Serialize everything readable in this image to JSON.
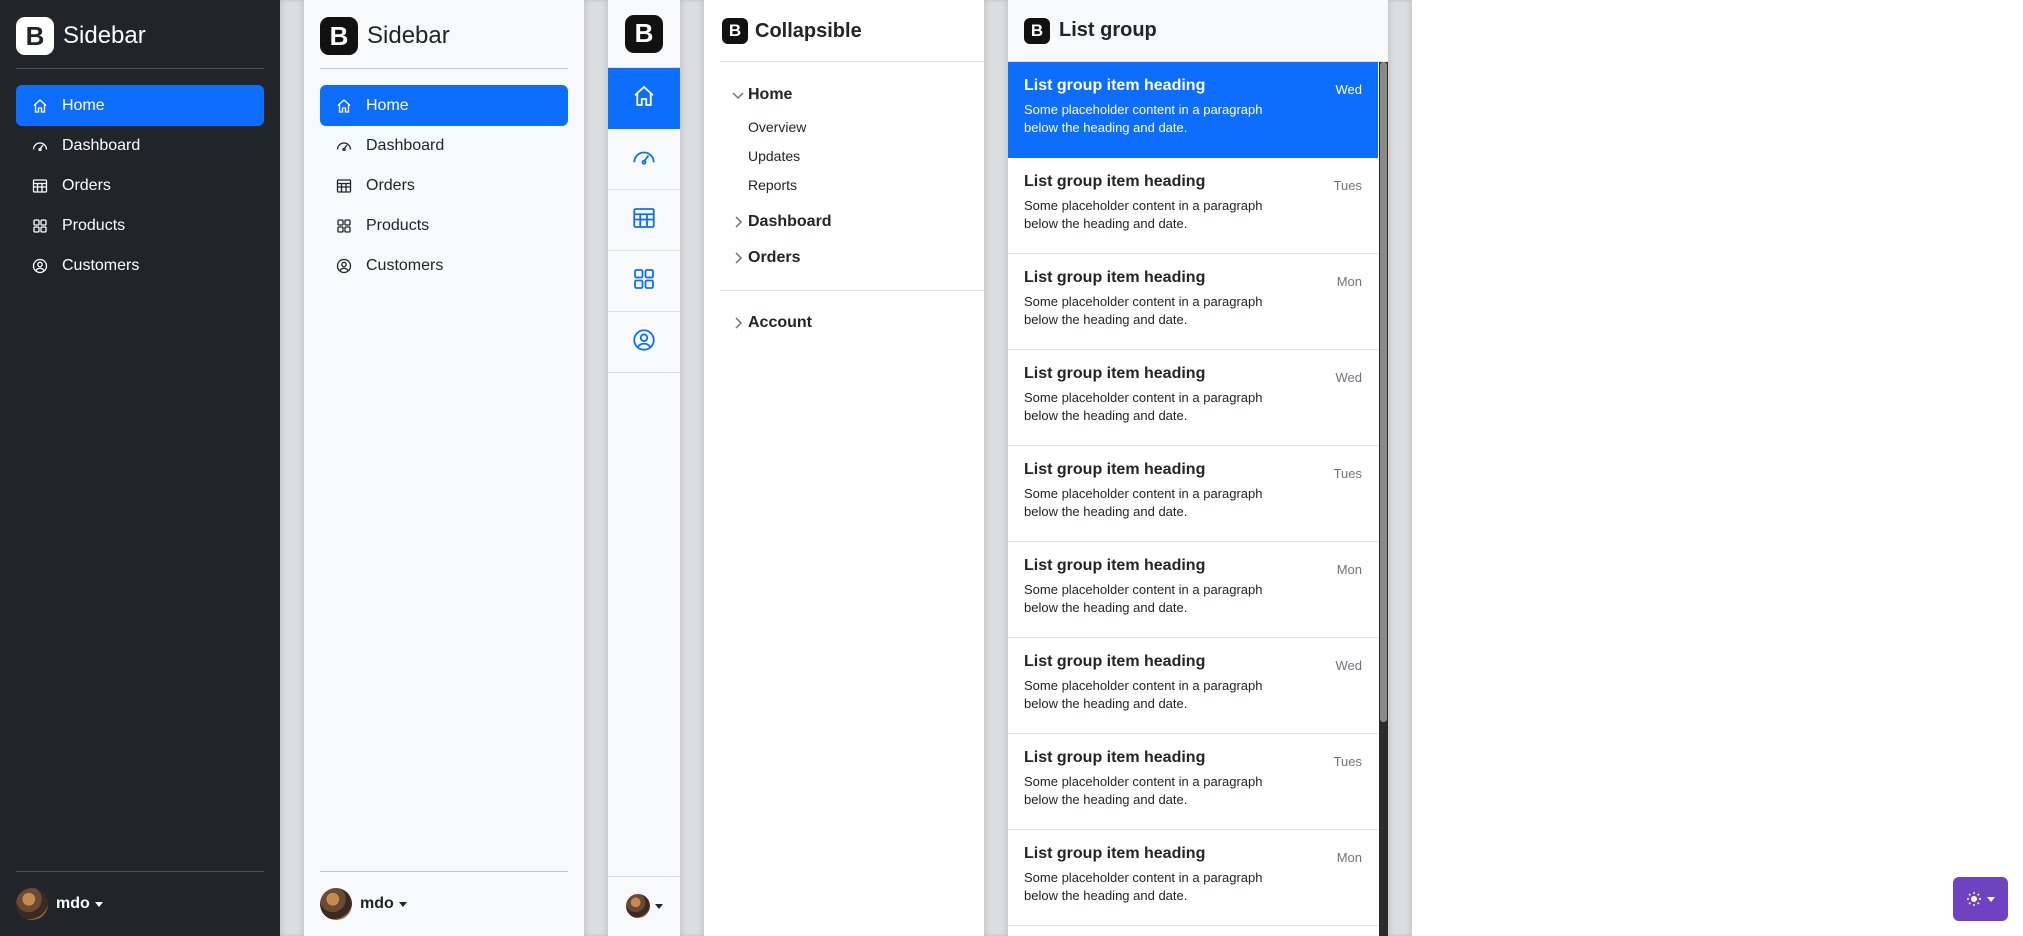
{
  "colors": {
    "primary": "#0d6efd",
    "dark_bg": "#212529",
    "light_bg": "#f8f9fa",
    "theme_btn": "#6f42c1"
  },
  "sidebar_dark": {
    "brand": "Sidebar",
    "items": [
      {
        "label": "Home",
        "icon": "home-icon"
      },
      {
        "label": "Dashboard",
        "icon": "speedometer-icon"
      },
      {
        "label": "Orders",
        "icon": "table-icon"
      },
      {
        "label": "Products",
        "icon": "grid-icon"
      },
      {
        "label": "Customers",
        "icon": "person-circle-icon"
      }
    ],
    "user": "mdo"
  },
  "sidebar_light": {
    "brand": "Sidebar",
    "items": [
      {
        "label": "Home",
        "icon": "home-icon"
      },
      {
        "label": "Dashboard",
        "icon": "speedometer-icon"
      },
      {
        "label": "Orders",
        "icon": "table-icon"
      },
      {
        "label": "Products",
        "icon": "grid-icon"
      },
      {
        "label": "Customers",
        "icon": "person-circle-icon"
      }
    ],
    "user": "mdo"
  },
  "icon_rail": {
    "items": [
      "home-icon",
      "speedometer-icon",
      "table-icon",
      "grid-icon",
      "person-circle-icon"
    ]
  },
  "collapsible": {
    "title": "Collapsible",
    "home": "Home",
    "home_children": [
      "Overview",
      "Updates",
      "Reports"
    ],
    "dashboard": "Dashboard",
    "orders": "Orders",
    "account": "Account"
  },
  "list_group": {
    "title": "List group",
    "items": [
      {
        "heading": "List group item heading",
        "text": "Some placeholder content in a paragraph below the heading and date.",
        "day": "Wed"
      },
      {
        "heading": "List group item heading",
        "text": "Some placeholder content in a paragraph below the heading and date.",
        "day": "Tues"
      },
      {
        "heading": "List group item heading",
        "text": "Some placeholder content in a paragraph below the heading and date.",
        "day": "Mon"
      },
      {
        "heading": "List group item heading",
        "text": "Some placeholder content in a paragraph below the heading and date.",
        "day": "Wed"
      },
      {
        "heading": "List group item heading",
        "text": "Some placeholder content in a paragraph below the heading and date.",
        "day": "Tues"
      },
      {
        "heading": "List group item heading",
        "text": "Some placeholder content in a paragraph below the heading and date.",
        "day": "Mon"
      },
      {
        "heading": "List group item heading",
        "text": "Some placeholder content in a paragraph below the heading and date.",
        "day": "Wed"
      },
      {
        "heading": "List group item heading",
        "text": "Some placeholder content in a paragraph below the heading and date.",
        "day": "Tues"
      },
      {
        "heading": "List group item heading",
        "text": "Some placeholder content in a paragraph below the heading and date.",
        "day": "Mon"
      }
    ]
  },
  "theme_toggle": {
    "icon": "sun-icon"
  }
}
